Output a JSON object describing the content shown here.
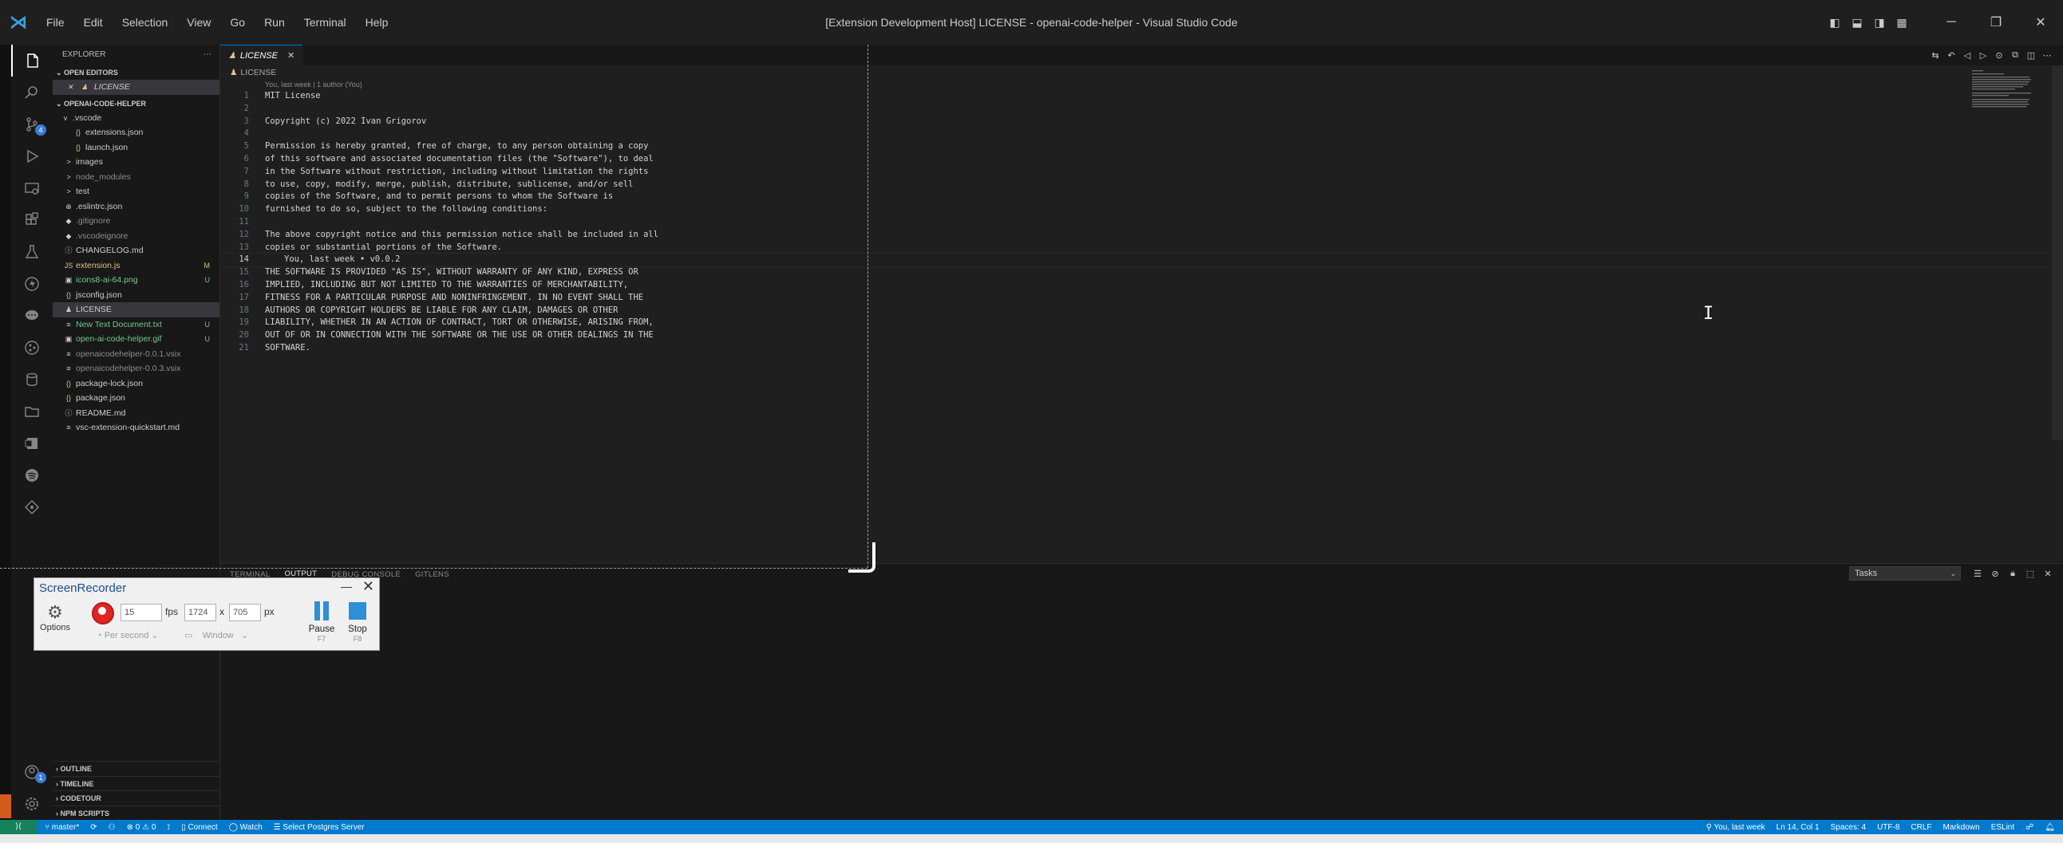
{
  "titlebar": {
    "title": "[Extension Development Host] LICENSE - openai-code-helper - Visual Studio Code",
    "menu": [
      "File",
      "Edit",
      "Selection",
      "View",
      "Go",
      "Run",
      "Terminal",
      "Help"
    ]
  },
  "activitybar": {
    "badges": {
      "source_control": "4"
    },
    "account_badge": "1"
  },
  "sidebar": {
    "header": "EXPLORER",
    "open_editors_title": "OPEN EDITORS",
    "open_editor": "LICENSE",
    "project_title": "OPENAI-CODE-HELPER",
    "tree": [
      {
        "label": ".vscode",
        "icon": "v",
        "status": ""
      },
      {
        "label": "extensions.json",
        "icon": "{}",
        "status": ""
      },
      {
        "label": "launch.json",
        "icon": "{}",
        "status": ""
      },
      {
        "label": "images",
        "icon": ">",
        "status": ""
      },
      {
        "label": "node_modules",
        "icon": ">",
        "status": ""
      },
      {
        "label": "test",
        "icon": ">",
        "status": ""
      },
      {
        "label": ".eslintrc.json",
        "icon": "⊗",
        "status": ""
      },
      {
        "label": ".gitignore",
        "icon": "◆",
        "status": ""
      },
      {
        "label": ".vscodeignore",
        "icon": "◆",
        "status": ""
      },
      {
        "label": "CHANGELOG.md",
        "icon": "ⓘ",
        "status": ""
      },
      {
        "label": "extension.js",
        "icon": "JS",
        "status": "M"
      },
      {
        "label": "icons8-ai-64.png",
        "icon": "▣",
        "status": "U"
      },
      {
        "label": "jsconfig.json",
        "icon": "{}",
        "status": ""
      },
      {
        "label": "LICENSE",
        "icon": "♟",
        "status": ""
      },
      {
        "label": "New Text Document.txt",
        "icon": "≡",
        "status": "U"
      },
      {
        "label": "open-ai-code-helper.gif",
        "icon": "▣",
        "status": "U"
      },
      {
        "label": "openaicodehelper-0.0.1.vsix",
        "icon": "≡",
        "status": ""
      },
      {
        "label": "openaicodehelper-0.0.3.vsix",
        "icon": "≡",
        "status": ""
      },
      {
        "label": "package-lock.json",
        "icon": "{}",
        "status": ""
      },
      {
        "label": "package.json",
        "icon": "{}",
        "status": ""
      },
      {
        "label": "README.md",
        "icon": "ⓘ",
        "status": ""
      },
      {
        "label": "vsc-extension-quickstart.md",
        "icon": "≡",
        "status": ""
      }
    ],
    "collapsed": [
      "OUTLINE",
      "TIMELINE",
      "CODETOUR",
      "NPM SCRIPTS"
    ]
  },
  "editor": {
    "tab": "LICENSE",
    "breadcrumb": "LICENSE",
    "codelens": "You, last week | 1 author (You)",
    "current_line": 14,
    "ghost_text": "You, last week • v0.0.2",
    "lines": [
      "MIT License",
      "",
      "Copyright (c) 2022 Ivan Grigorov",
      "",
      "Permission is hereby granted, free of charge, to any person obtaining a copy",
      "of this software and associated documentation files (the \"Software\"), to deal",
      "in the Software without restriction, including without limitation the rights",
      "to use, copy, modify, merge, publish, distribute, sublicense, and/or sell",
      "copies of the Software, and to permit persons to whom the Software is",
      "furnished to do so, subject to the following conditions:",
      "",
      "The above copyright notice and this permission notice shall be included in all",
      "copies or substantial portions of the Software.",
      "",
      "THE SOFTWARE IS PROVIDED \"AS IS\", WITHOUT WARRANTY OF ANY KIND, EXPRESS OR",
      "IMPLIED, INCLUDING BUT NOT LIMITED TO THE WARRANTIES OF MERCHANTABILITY,",
      "FITNESS FOR A PARTICULAR PURPOSE AND NONINFRINGEMENT. IN NO EVENT SHALL THE",
      "AUTHORS OR COPYRIGHT HOLDERS BE LIABLE FOR ANY CLAIM, DAMAGES OR OTHER",
      "LIABILITY, WHETHER IN AN ACTION OF CONTRACT, TORT OR OTHERWISE, ARISING FROM,",
      "OUT OF OR IN CONNECTION WITH THE SOFTWARE OR THE USE OR OTHER DEALINGS IN THE",
      "SOFTWARE."
    ]
  },
  "panel": {
    "tabs": [
      "TERMINAL",
      "OUTPUT",
      "DEBUG CONSOLE",
      "GITLENS"
    ],
    "active_tab": "OUTPUT",
    "task_select": "Tasks"
  },
  "recorder": {
    "title": "ScreenRecorder",
    "options_label": "Options",
    "fps_value": "15",
    "fps_label": "fps",
    "width_value": "1724",
    "times": "x",
    "height_value": "705",
    "px_label": "px",
    "per_second": "Per second",
    "window": "Window",
    "pause_label": "Pause",
    "pause_key": "F7",
    "stop_label": "Stop",
    "stop_key": "F8"
  },
  "statusbar": {
    "branch": "master*",
    "errors": "0",
    "warnings": "0",
    "connect": "Connect",
    "watch": "Watch",
    "postgres": "Select Postgres Server",
    "blame": "You, last week",
    "position": "Ln 14, Col 1",
    "spaces": "Spaces: 4",
    "encoding": "UTF-8",
    "eol": "CRLF",
    "language": "Markdown",
    "linter": "ESLint"
  },
  "colors": {
    "accent": "#007acc",
    "remote": "#16825d",
    "modified": "#e2c08d",
    "untracked": "#73c991"
  }
}
